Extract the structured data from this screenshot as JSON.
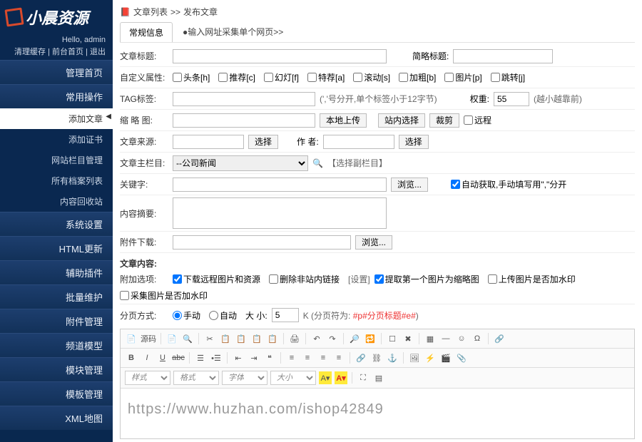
{
  "logo": "小晨资源",
  "hello": "Hello, admin",
  "topbar": {
    "clean": "清理缓存",
    "front": "前台首页",
    "logout": "退出"
  },
  "menu": {
    "home": "管理首页",
    "common": "常用操作",
    "items": [
      "添加文章",
      "添加证书",
      "网站栏目管理",
      "所有档案列表",
      "内容回收站"
    ],
    "sys": "系统设置",
    "html": "HTML更新",
    "plugin": "辅助插件",
    "batch": "批量维护",
    "attach": "附件管理",
    "channel": "频道模型",
    "module": "模块管理",
    "template": "模板管理",
    "xml": "XML地图"
  },
  "crumb": {
    "list": "文章列表",
    "sep": ">>",
    "publish": "发布文章"
  },
  "tabs": {
    "t1": "常规信息",
    "t2": "●输入网址采集单个网页>>"
  },
  "labels": {
    "title": "文章标题:",
    "shorttitle": "简略标题:",
    "attr": "自定义属性:",
    "tag": "TAG标签:",
    "thumb": "缩 略 图:",
    "source": "文章来源:",
    "author": "作  者:",
    "category": "文章主栏目:",
    "keywords": "关键字:",
    "summary": "内容摘要:",
    "dl": "附件下载:",
    "content": "文章内容:",
    "extra": "附加选项:",
    "paging": "分页方式:",
    "weight": "权重:",
    "size": "大 小:"
  },
  "attrs": {
    "a1": "头条[h]",
    "a2": "推荐[c]",
    "a3": "幻灯[f]",
    "a4": "特荐[a]",
    "a5": "滚动[s]",
    "a6": "加粗[b]",
    "a7": "图片[p]",
    "a8": "跳转[j]"
  },
  "notes": {
    "tag": "(','号分开,单个标签小于12字节)",
    "weight": "(越小越靠前)",
    "subcat": "【选择副栏目】",
    "kwauto": " 自动获取,手动填写用\",\"分开",
    "pagingHint": "K (分页符为: ",
    "pagingSym": "#p#分页标题#e#",
    "pagingClose": ")"
  },
  "btns": {
    "localUp": "本地上传",
    "siteSel": "站内选择",
    "crop": "裁剪",
    "remote": "远程",
    "pick": "选择",
    "browse": "浏览..."
  },
  "opts": {
    "o1": "下载远程图片和资源",
    "o2": "删除非站内链接",
    "o2set": "[设置]",
    "o3": "提取第一个图片为缩略图",
    "o4": "上传图片是否加水印",
    "o5": "采集图片是否加水印"
  },
  "paging": {
    "manual": "手动",
    "auto": "自动"
  },
  "vals": {
    "weight": "55",
    "category": "--公司新闻",
    "pagesize": "5"
  },
  "editor": {
    "src": "源码",
    "body": "https://www.huzhan.com/ishop42849",
    "sel": {
      "fmt": "样式",
      "font": "格式",
      "ff": "字体",
      "fs": "大小"
    }
  }
}
